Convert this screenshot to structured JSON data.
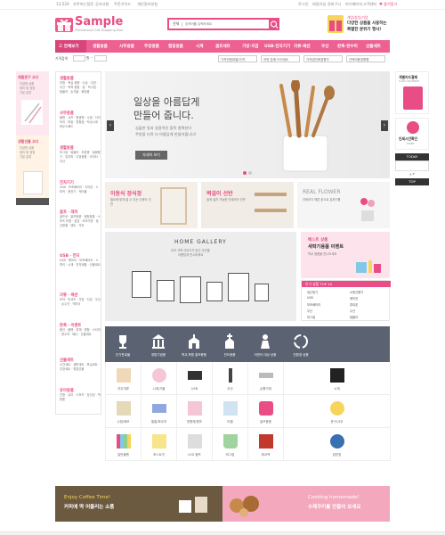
{
  "topbar": {
    "left": [
      "13,520",
      "자주하는질문",
      "공지사항",
      "주문가이드",
      "개인정보방침"
    ],
    "right": [
      "로그인",
      "회원가입",
      "장바구니",
      "마이페이지",
      "고객센터",
      "♥ 즐겨찾기"
    ]
  },
  "brand": {
    "name": "Sample",
    "tagline": "Promotional Gift Shopping Mall",
    "accent": "#e84d85"
  },
  "search": {
    "scope": "전체",
    "placeholder": "검색어를 입력하세요"
  },
  "promo": {
    "line1": "개업/창업/기념",
    "line2": "다양한 상품을 사용하는",
    "line3": "특별한 분위기 행사!"
  },
  "nav": {
    "all": "☰ 전체보기",
    "items": [
      "생활용품",
      "사무용품",
      "주방용품",
      "캠핑용품",
      "시계",
      "골프세트",
      "가방·지갑",
      "USB·전자기기",
      "의류·패션",
      "우산",
      "판촉·판수피",
      "선물세트"
    ]
  },
  "filters": {
    "label": "가격검색",
    "range": "원 ~",
    "selects": [
      "가격연령대별/가격",
      "어떤 분께 드리세요",
      "가격경인화경향가",
      "선택여용경향향"
    ]
  },
  "left_side": {
    "t1": "제품문구 코너",
    "t2": "다양한 상품",
    "t3": "정리 및 정정",
    "t4": "기본 분류",
    "t5": "생활선물 코너",
    "t6": "다양한 상품",
    "t7": "정리 및 정정",
    "t8": "기본 분류"
  },
  "categories": [
    {
      "h": "생활용품",
      "b": "타월 · 욕실 용품 · 수납 · 주방 · 우산 · 목욕 용품 · 컵 · 머그컵 · 텀블러 · 손거울 · 화장품"
    },
    {
      "h": "사무용품",
      "b": "볼펜 · 샤프 · 형광펜 · 수첩 · 다이어리 · 파일 · 명함첩 · 탁상시계 · 마우스패드"
    },
    {
      "h": "생활용품",
      "b": "머그컵 · 텀블러 · 보온병 · 밀폐용기 · 앞치마 · 주방용품 · 라이터 · 우산"
    },
    {
      "h": "전자기기",
      "b": "USB · 보조배터리 · 이어폰 · 스피커 · 충전기 · 케이블"
    },
    {
      "h": "골프 · 레저",
      "b": "골프공 · 골프용품 · 캠핑용품 · 스포츠 타월 · 장갑 · 보조가방 · 등산용품 · 텐트 · 의자"
    },
    {
      "h": "USB · 전자",
      "b": "USB · 메모리 · 보조배터리 · 스피커 · 시계 · 전자제품 · 선물세트"
    },
    {
      "h": "의류 · 패션",
      "b": "모자 · 티셔츠 · 가방 · 지갑 · 우산 · 손수건 · 넥타이"
    },
    {
      "h": "판촉 · 이벤트",
      "b": "풍선 · 볼펜 · 부채 · 명함 · 스티커 · 현수막 · 배너 · 선물세트"
    },
    {
      "h": "선물세트",
      "b": "수건세트 · 생활세트 · 욕실세트 · 주방세트 · 명절선물"
    },
    {
      "h": "유아용품",
      "b": "인형 · 유아 · 스포츠 · 장난감 · 학용품"
    }
  ],
  "hero": {
    "title1": "일상을 아름답게",
    "title2": "만들어 줍니다.",
    "desc1": "심플한 멋과 실용적인 품목 컬렉션이",
    "desc2": "주방을 더욱 더 아름답게 만들어줍니다!",
    "button": "자세히 보기"
  },
  "mini": [
    {
      "h": "이동식 장식장",
      "d": "필요에 맞게 쓸 수 있는 다용도 선반"
    },
    {
      "h": "벽걸이 선반",
      "d": "쉽게 설치 가능한 인테리어 선반"
    },
    {
      "h": "REAL FLOWER",
      "d": "진짜보다 예쁜 꽃으로 분위기를"
    }
  ],
  "gallery": {
    "title": "HOME GALLERY",
    "sub1": "우리 가족 이야기가 담긴 사진을",
    "sub2": "아름답게 전시하세요"
  },
  "event": {
    "h1": "베스트 상품",
    "h2": "새학기용품 이벤트",
    "sub": "학교 용품을 만나보세요"
  },
  "bestlist": {
    "title": "인기 상품 TOP 10",
    "items": [
      "냉난방기",
      "소형선풍기",
      "USB",
      "에어컨",
      "보조배터리",
      "휴대폰",
      "우산",
      "수건",
      "머그컵",
      "텀블러"
    ]
  },
  "icons": [
    {
      "label": "인기판촉물",
      "icon": "trophy-icon"
    },
    {
      "label": "창립기념품",
      "icon": "building-icon"
    },
    {
      "label": "학교,학원 홍보용품",
      "icon": "school-icon"
    },
    {
      "label": "전도용품",
      "icon": "church-icon"
    },
    {
      "label": "어린이 대상 상품",
      "icon": "child-icon"
    },
    {
      "label": "친환경 상품",
      "icon": "recycle-icon"
    },
    {
      "label": "",
      "icon": "blank-icon"
    },
    {
      "label": "",
      "icon": "blank-icon"
    }
  ],
  "products": [
    "지우개류",
    "시계/거울",
    "USB",
    "우산",
    "손톱가위",
    "시계",
    "수첩/메모",
    "필통/파우치",
    "방향제/향초",
    "타월",
    "골프용품",
    "문구/사무",
    "일반볼펜",
    "포스트잇",
    "LED 램프",
    "머그컵",
    "에코백",
    "컵받침"
  ],
  "bottom": {
    "l1": "Enjoy Coffee Time!",
    "l2": "커피에 딱 어울리는 소품",
    "r1": "Cooking homemade!",
    "r2": "수제쿠키를 만들어 보세요"
  },
  "right_side": {
    "a1": "개별카드결제",
    "a2": "CARD PAYMENT",
    "b1": "인쇄시안확인",
    "b2": "PRINT",
    "today": "TODAY",
    "top": "TOP"
  }
}
